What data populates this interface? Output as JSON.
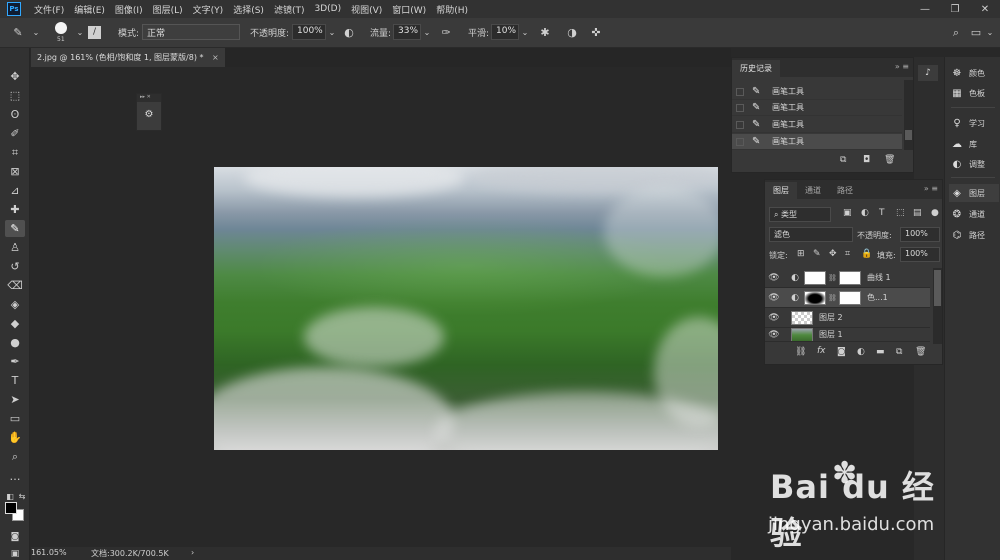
{
  "app": {
    "logo": "Ps"
  },
  "menu": [
    "文件(F)",
    "编辑(E)",
    "图像(I)",
    "图层(L)",
    "文字(Y)",
    "选择(S)",
    "滤镜(T)",
    "3D(D)",
    "视图(V)",
    "窗口(W)",
    "帮助(H)"
  ],
  "window_controls": {
    "minimize": "—",
    "restore": "❐",
    "close": "✕"
  },
  "options": {
    "brush_size": "51",
    "mode_label": "模式:",
    "mode_value": "正常",
    "opacity_label": "不透明度:",
    "opacity_value": "100%",
    "flow_label": "流量:",
    "flow_value": "33%",
    "smoothing_label": "平滑:",
    "smoothing_value": "10%"
  },
  "doc_tab": {
    "title": "2.jpg @ 161% (色相/饱和度 1, 图层蒙版/8) *",
    "close": "×"
  },
  "history_panel": {
    "tab": "历史记录",
    "items": [
      "画笔工具",
      "画笔工具",
      "画笔工具",
      "画笔工具"
    ]
  },
  "layers_panel": {
    "tabs": [
      "图层",
      "通道",
      "路径"
    ],
    "filter_kind": "类型",
    "blend_mode": "滤色",
    "opacity_label": "不透明度:",
    "opacity_value": "100%",
    "lock_label": "锁定:",
    "fill_label": "填充:",
    "fill_value": "100%",
    "layers": [
      {
        "name": "曲线 1"
      },
      {
        "name": "色...1"
      },
      {
        "name": "图层 2"
      },
      {
        "name": "图层 1"
      }
    ]
  },
  "right_column": {
    "group1": [
      "颜色",
      "色板"
    ],
    "group2": [
      "学习",
      "库",
      "调整"
    ],
    "group3": [
      "图层",
      "通道",
      "路径"
    ]
  },
  "status": {
    "zoom": "161.05%",
    "doc": "文档:300.2K/700.5K",
    "arrow": "›"
  },
  "watermark": {
    "logo_text": "Bai du 经验",
    "url": "jingyan.baidu.com"
  }
}
